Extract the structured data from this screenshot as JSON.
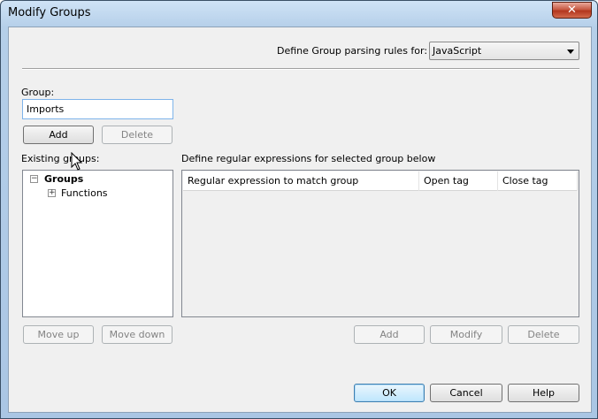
{
  "window": {
    "title": "Modify Groups",
    "close_glyph": "✕"
  },
  "parsing": {
    "label": "Define Group parsing rules for:",
    "selected": "JavaScript"
  },
  "group": {
    "label": "Group:",
    "value": "Imports",
    "add_label": "Add",
    "delete_label": "Delete"
  },
  "existing": {
    "label": "Existing groups:",
    "root": "Groups",
    "children": [
      "Functions"
    ],
    "move_up_label": "Move up",
    "move_down_label": "Move down"
  },
  "regex": {
    "label": "Define regular expressions for selected group below",
    "columns": [
      "Regular expression to match group",
      "Open tag",
      "Close tag"
    ],
    "add_label": "Add",
    "modify_label": "Modify",
    "delete_label": "Delete"
  },
  "footer": {
    "ok_label": "OK",
    "cancel_label": "Cancel",
    "help_label": "Help"
  }
}
